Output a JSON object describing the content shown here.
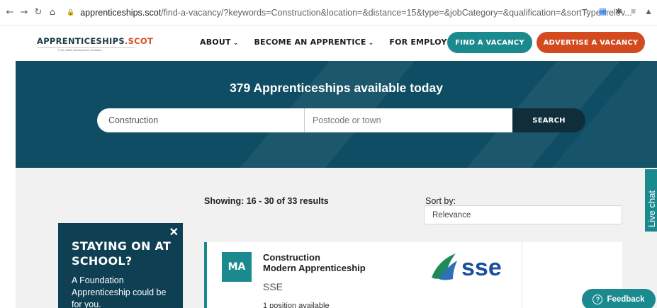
{
  "browser": {
    "back": "←",
    "forward": "→",
    "reload": "↻",
    "home": "⌂",
    "url_domain": "apprenticeships.scot",
    "url_path": "/find-a-vacancy/?keywords=Construction&location=&distance=15&type=&jobCategory=&qualification=&sortType=relev..."
  },
  "header": {
    "logo_main": "APPRENTICESHIPS",
    "logo_dot_scot": ".SCOT",
    "logo_sub": "From Skills Development Scotland",
    "nav": [
      {
        "label": "ABOUT"
      },
      {
        "label": "BECOME AN APPRENTICE"
      },
      {
        "label": "FOR EMPLOYERS"
      }
    ],
    "find_vacancy": "FIND A VACANCY",
    "advertise_vacancy": "ADVERTISE A VACANCY"
  },
  "hero": {
    "title": "379 Apprenticeships available today",
    "keyword_value": "Construction",
    "location_placeholder": "Postcode or town",
    "search_button": "SEARCH"
  },
  "results": {
    "count_text": "Showing: 16 - 30 of 33 results",
    "sort_label": "Sort by:",
    "sort_value": "Relevance"
  },
  "promo": {
    "title": "STAYING ON AT SCHOOL?",
    "body": "A Foundation Apprenticeship could be for you.",
    "close": "✕"
  },
  "card": {
    "badge": "MA",
    "title_line1": "Construction",
    "title_line2": "Modern Apprenticeship",
    "employer": "SSE",
    "positions": "1 position available",
    "logo_text": "sse"
  },
  "live_chat": "Live chat",
  "feedback": "Feedback",
  "colors": {
    "teal": "#1a8a8f",
    "orange": "#d34a1f",
    "navy": "#0e4d63",
    "promo": "#0e3f52"
  }
}
